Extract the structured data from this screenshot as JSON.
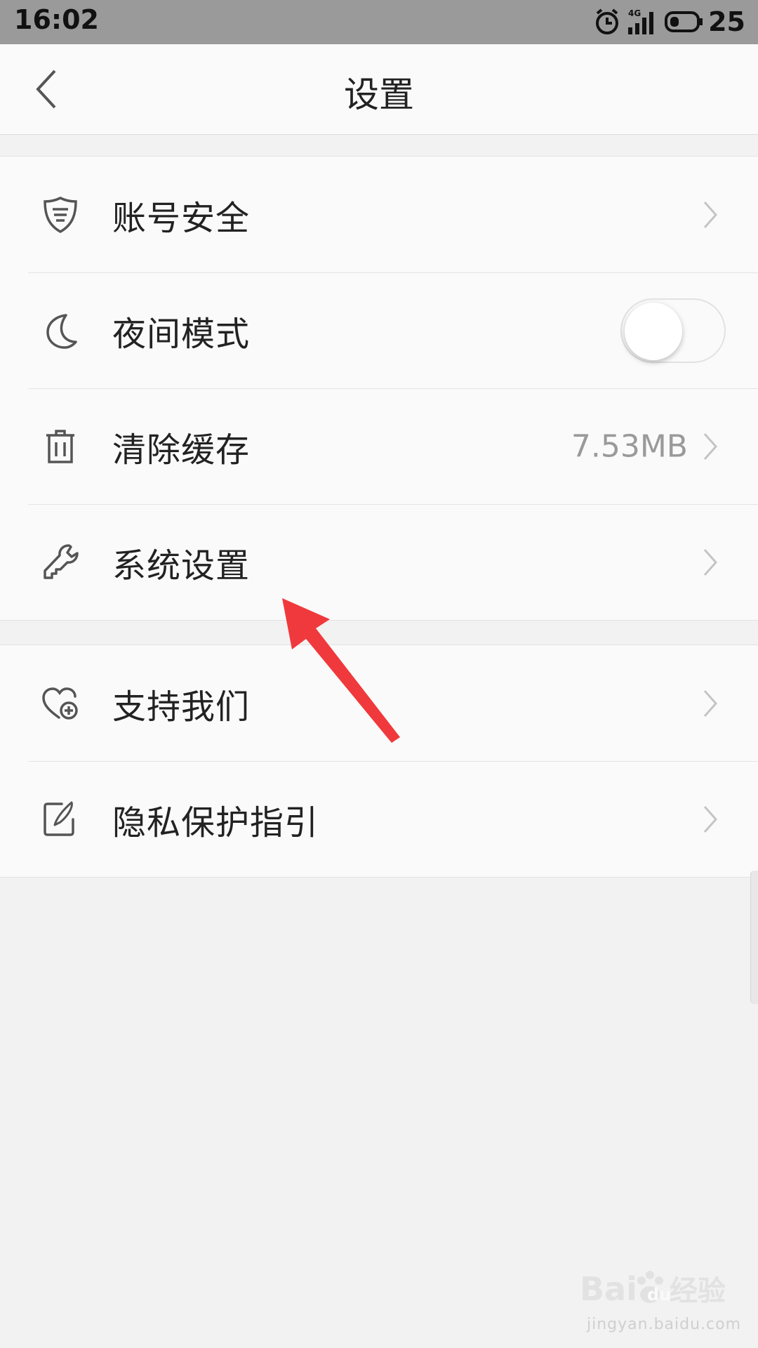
{
  "status_bar": {
    "time": "16:02",
    "network": "4G",
    "battery_level": "25",
    "icons": [
      "alarm-icon",
      "signal-icon",
      "battery-icon"
    ]
  },
  "nav": {
    "title": "设置",
    "back_icon": "chevron-left-icon"
  },
  "groups": [
    {
      "items": [
        {
          "label": "账号安全",
          "icon": "shield-icon",
          "trailing": "chevron"
        },
        {
          "label": "夜间模式",
          "icon": "moon-icon",
          "trailing": "toggle",
          "toggle_on": false
        },
        {
          "label": "清除缓存",
          "icon": "trash-icon",
          "trailing": "chevron",
          "value": "7.53MB"
        },
        {
          "label": "系统设置",
          "icon": "wrench-icon",
          "trailing": "chevron"
        }
      ]
    },
    {
      "items": [
        {
          "label": "支持我们",
          "icon": "heart-plus-icon",
          "trailing": "chevron"
        },
        {
          "label": "隐私保护指引",
          "icon": "edit-note-icon",
          "trailing": "chevron"
        }
      ]
    }
  ],
  "colors": {
    "status_bar": "#9a9a9a",
    "background": "#f2f2f2",
    "list_background": "#fafafa",
    "annotation_arrow": "#f0393c",
    "secondary_text": "#9a9a9a"
  },
  "watermark": {
    "logo": "Baidu经验",
    "url": "jingyan.baidu.com"
  }
}
